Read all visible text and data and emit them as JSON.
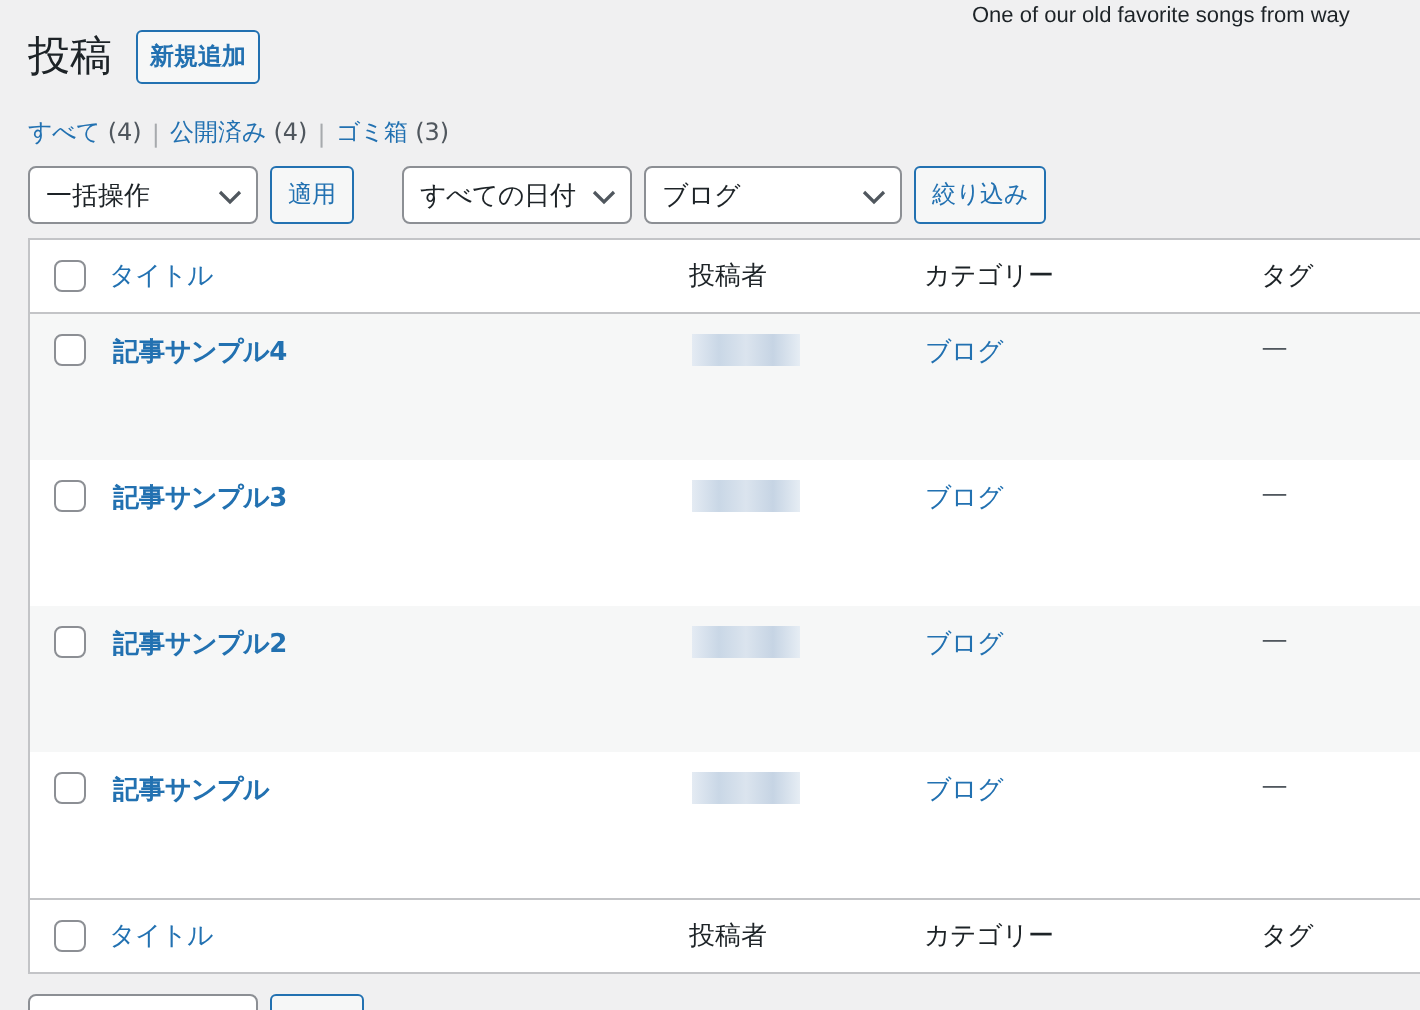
{
  "top_notice": "One of our old favorite songs from way",
  "page_title": "投稿",
  "add_new_button": "新規追加",
  "status_filters": [
    {
      "label": "すべて",
      "count": "(4)",
      "selected": false
    },
    {
      "label": "公開済み",
      "count": "(4)",
      "selected": false,
      "separator": "|"
    },
    {
      "label": "ゴミ箱",
      "count": "(3)",
      "selected": false,
      "separator": "|"
    }
  ],
  "toolbar": {
    "bulk_action": "一括操作",
    "apply_button": "適用",
    "date_filter": "すべての日付",
    "category_filter": "ブログ",
    "filter_button": "絞り込み"
  },
  "table": {
    "header_checked": false,
    "columns": [
      "タイトル",
      "投稿者",
      "カテゴリー",
      "タグ"
    ],
    "rows": [
      {
        "checked": false,
        "title": "記事サンプル4",
        "category": "ブログ",
        "tags": "—"
      },
      {
        "checked": false,
        "title": "記事サンプル3",
        "category": "ブログ",
        "tags": "—"
      },
      {
        "checked": false,
        "title": "記事サンプル2",
        "category": "ブログ",
        "tags": "—"
      },
      {
        "checked": false,
        "title": "記事サンプル",
        "category": "ブログ",
        "tags": "—"
      }
    ],
    "footer_checked": false,
    "footer_columns": [
      "タイトル",
      "投稿者",
      "カテゴリー",
      "タグ"
    ]
  }
}
